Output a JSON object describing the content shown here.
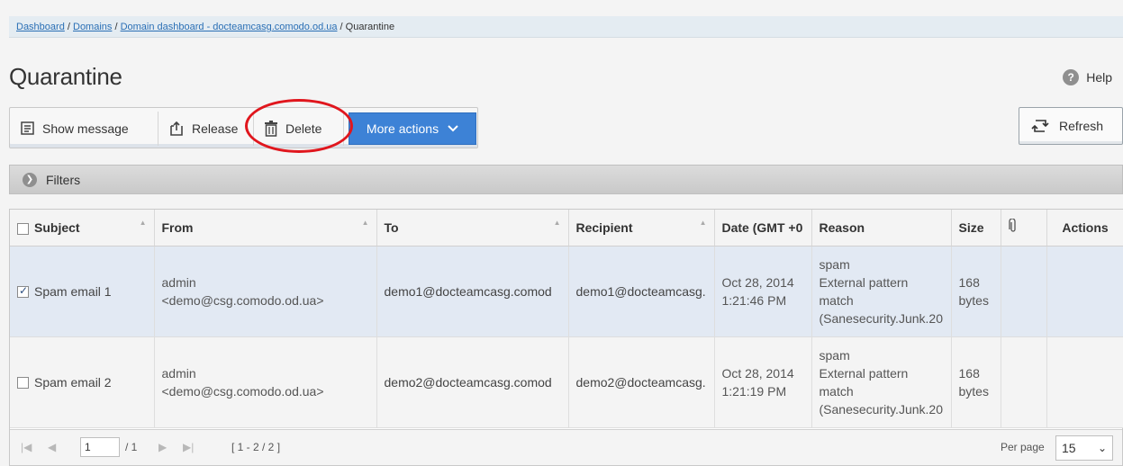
{
  "breadcrumb": {
    "items": [
      "Dashboard",
      "Domains",
      "Domain dashboard - docteamcasg.comodo.od.ua"
    ],
    "current": "Quarantine",
    "separator": " / "
  },
  "page": {
    "title": "Quarantine",
    "help_label": "Help",
    "help_icon": "?"
  },
  "toolbar": {
    "show_message": "Show message",
    "release": "Release",
    "delete": "Delete",
    "more_actions": "More actions",
    "refresh": "Refresh"
  },
  "filters": {
    "label": "Filters"
  },
  "table": {
    "columns": [
      "Subject",
      "From",
      "To",
      "Recipient",
      "Date (GMT +0",
      "Reason",
      "Size",
      "",
      "Actions"
    ],
    "rows": [
      {
        "checked": true,
        "subject": "Spam email 1",
        "from_name": "admin",
        "from_email": "<demo@csg.comodo.od.ua>",
        "to": "demo1@docteamcasg.comod",
        "recipient": "demo1@docteamcasg.",
        "date": "Oct 28, 2014",
        "time": "1:21:46 PM",
        "reason": [
          "spam",
          "External pattern",
          "match",
          "(Sanesecurity.Junk.20"
        ],
        "size": "168",
        "size_unit": "bytes"
      },
      {
        "checked": false,
        "subject": "Spam email 2",
        "from_name": "admin",
        "from_email": "<demo@csg.comodo.od.ua>",
        "to": "demo2@docteamcasg.comod",
        "recipient": "demo2@docteamcasg.",
        "date": "Oct 28, 2014",
        "time": "1:21:19 PM",
        "reason": [
          "spam",
          "External pattern",
          "match",
          "(Sanesecurity.Junk.20"
        ],
        "size": "168",
        "size_unit": "bytes"
      }
    ]
  },
  "pager": {
    "page_value": "1",
    "of_pages": "/ 1",
    "range": "[ 1 - 2 / 2 ]",
    "per_page_label": "Per page",
    "per_page_value": "15"
  },
  "colors": {
    "accent": "#3d82d6",
    "highlight": "#e0161d",
    "selected_row": "#e2e9f3"
  }
}
